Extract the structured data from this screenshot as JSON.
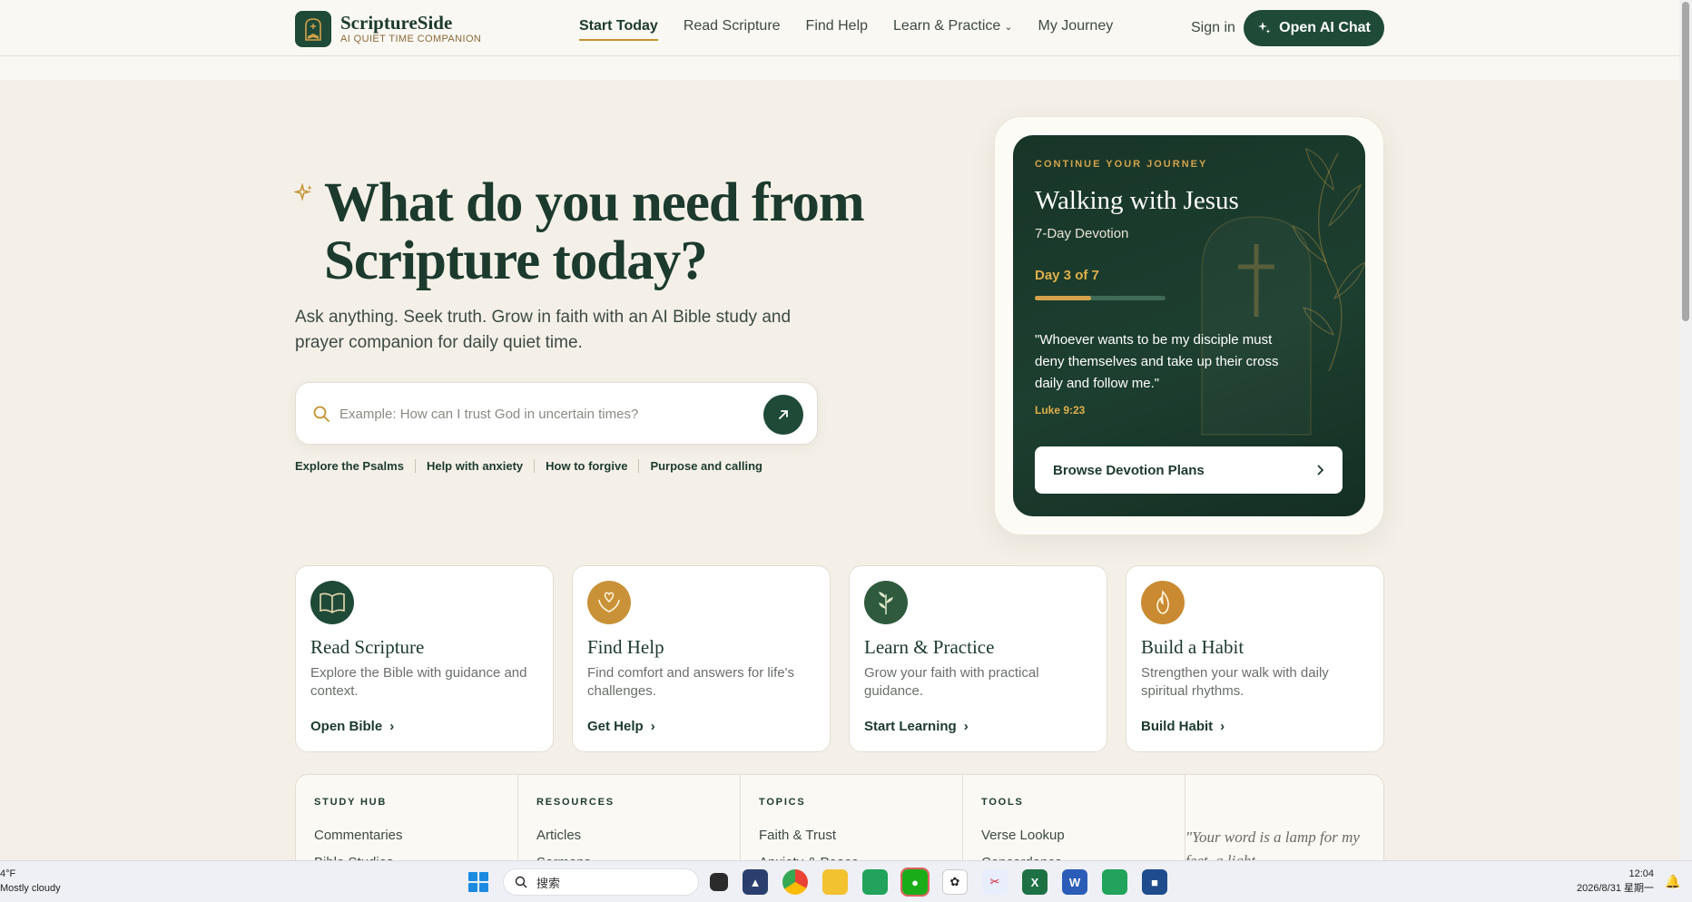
{
  "nav": {
    "brand_name": "ScriptureSide",
    "brand_tagline": "AI QUIET TIME COMPANION",
    "links": [
      {
        "label": "Start Today",
        "active": true
      },
      {
        "label": "Read Scripture"
      },
      {
        "label": "Find Help"
      },
      {
        "label": "Learn & Practice",
        "dropdown": true
      },
      {
        "label": "My Journey"
      }
    ],
    "sign_in": "Sign in",
    "chat_button": "Open AI Chat"
  },
  "hero": {
    "title": "What do you need from Scripture today?",
    "subtitle": "Ask anything. Seek truth. Grow in faith with an AI Bible study and prayer companion for daily quiet time.",
    "search_placeholder": "Example: How can I trust God in uncertain times?",
    "quick_links": [
      "Explore the Psalms",
      "Help with anxiety",
      "How to forgive",
      "Purpose and calling"
    ]
  },
  "journey": {
    "eyebrow": "CONTINUE YOUR JOURNEY",
    "title": "Walking with Jesus",
    "subtitle": "7-Day Devotion",
    "day_label": "Day 3 of 7",
    "progress": 0.43,
    "quote": "\"Whoever wants to be my disciple must deny themselves and take up their cross daily and follow me.\"",
    "reference": "Luke 9:23",
    "button": "Browse Devotion Plans"
  },
  "cards": [
    {
      "title": "Read Scripture",
      "desc": "Explore the Bible with guidance and context.",
      "cta": "Open Bible",
      "icon": "book-icon",
      "color": "#1f4a38"
    },
    {
      "title": "Find Help",
      "desc": "Find comfort and answers for life's challenges.",
      "cta": "Get Help",
      "icon": "heart-hands-icon",
      "color": "#c99238"
    },
    {
      "title": "Learn & Practice",
      "desc": "Grow your faith with practical guidance.",
      "cta": "Start Learning",
      "icon": "leaf-icon",
      "color": "#2f5a3e"
    },
    {
      "title": "Build a Habit",
      "desc": "Strengthen your walk with daily spiritual rhythms.",
      "cta": "Build Habit",
      "icon": "flame-icon",
      "color": "#c98a32"
    }
  ],
  "links_panel": {
    "columns": [
      {
        "head": "STUDY HUB",
        "first": "Commentaries",
        "second": "Bible Studies"
      },
      {
        "head": "RESOURCES",
        "first": "Articles",
        "second": "Sermons"
      },
      {
        "head": "TOPICS",
        "first": "Faith & Trust",
        "second": "Anxiety & Peace"
      },
      {
        "head": "TOOLS",
        "first": "Verse Lookup",
        "second": "Concordance"
      }
    ],
    "verse": "\"Your word is a lamp for my feet, a light"
  },
  "taskbar": {
    "temp": "4°F",
    "weather": "Mostly cloudy",
    "search": "搜索",
    "time": "12:04",
    "date": "2026/8/31 星期一"
  }
}
